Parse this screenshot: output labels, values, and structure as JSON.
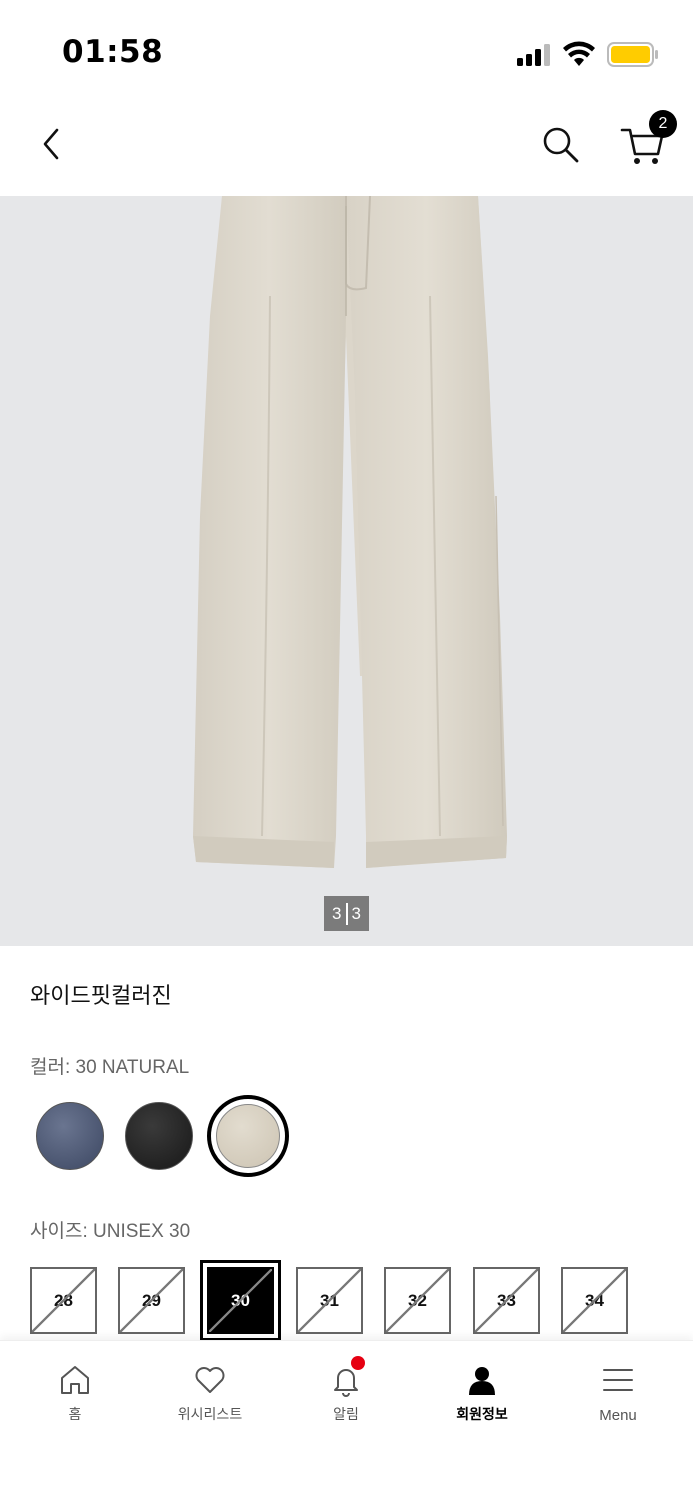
{
  "status_bar": {
    "time": "01:58"
  },
  "header": {
    "cart_count": "2"
  },
  "gallery": {
    "current": "3",
    "total": "3"
  },
  "product": {
    "name": "와이드핏컬러진",
    "color_label": "컬러: 30 NATURAL",
    "size_label": "사이즈: UNISEX 30",
    "colors": [
      {
        "name": "navy",
        "hex": "#4f5a75"
      },
      {
        "name": "black",
        "hex": "#262626"
      },
      {
        "name": "natural",
        "hex": "#d6cfbf",
        "selected": true
      }
    ],
    "sizes": [
      {
        "label": "28",
        "available": false
      },
      {
        "label": "29",
        "available": false
      },
      {
        "label": "30",
        "available": false,
        "selected": true
      },
      {
        "label": "31",
        "available": false
      },
      {
        "label": "32",
        "available": false
      },
      {
        "label": "33",
        "available": false
      },
      {
        "label": "34",
        "available": false
      }
    ]
  },
  "tab_bar": {
    "home": "홈",
    "wishlist": "위시리스트",
    "alerts": "알림",
    "member": "회원정보",
    "menu": "Menu"
  },
  "colors": {
    "image_bg": "#e6e7e9",
    "notification_dot": "#e60012",
    "battery": "#ffcc00"
  },
  "icons": [
    "back-icon",
    "search-icon",
    "cart-icon",
    "home-icon",
    "heart-icon",
    "bell-icon",
    "person-icon",
    "hamburger-icon"
  ]
}
